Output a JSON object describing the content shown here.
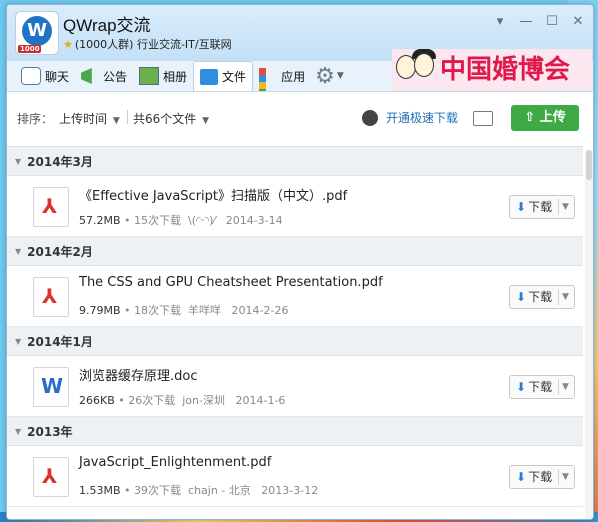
{
  "window": {
    "group_name": "QWrap交流",
    "group_meta": "(1000人群) 行业交流-IT/互联网",
    "logo_tag": "1000"
  },
  "banner": {
    "text": "中国婚博会"
  },
  "toolbar": {
    "items": [
      {
        "label": "聊天",
        "icon": "chat-icon"
      },
      {
        "label": "公告",
        "icon": "notice-icon"
      },
      {
        "label": "相册",
        "icon": "photo-icon"
      },
      {
        "label": "文件",
        "icon": "folder-icon"
      },
      {
        "label": "应用",
        "icon": "apps-icon"
      }
    ]
  },
  "filter": {
    "sort_label": "排序：",
    "sort_value": "上传时间",
    "count": "共66个文件",
    "turbo": "开通极速下载",
    "upload": "上传"
  },
  "sections": [
    {
      "title": "2014年3月",
      "files": [
        {
          "name": "《Effective JavaScript》扫描版（中文）.pdf",
          "size": "57.2MB",
          "downloads": "15次下载",
          "uploader": "\\(◜ᵕ◝)⁄",
          "date": "2014-3-14",
          "type": "pdf"
        }
      ]
    },
    {
      "title": "2014年2月",
      "files": [
        {
          "name": "The CSS and GPU Cheatsheet Presentation.pdf",
          "size": "9.79MB",
          "downloads": "18次下载",
          "uploader": "羊咩咩",
          "date": "2014-2-26",
          "type": "pdf"
        }
      ]
    },
    {
      "title": "2014年1月",
      "files": [
        {
          "name": "浏览器缓存原理.doc",
          "size": "266KB",
          "downloads": "26次下载",
          "uploader": "jon-深圳",
          "date": "2014-1-6",
          "type": "doc"
        }
      ]
    },
    {
      "title": "2013年",
      "files": [
        {
          "name": "JavaScript_Enlightenment.pdf",
          "size": "1.53MB",
          "downloads": "39次下载",
          "uploader": "chajn - 北京",
          "date": "2013-3-12",
          "type": "pdf"
        }
      ]
    }
  ],
  "download_label": "下载"
}
